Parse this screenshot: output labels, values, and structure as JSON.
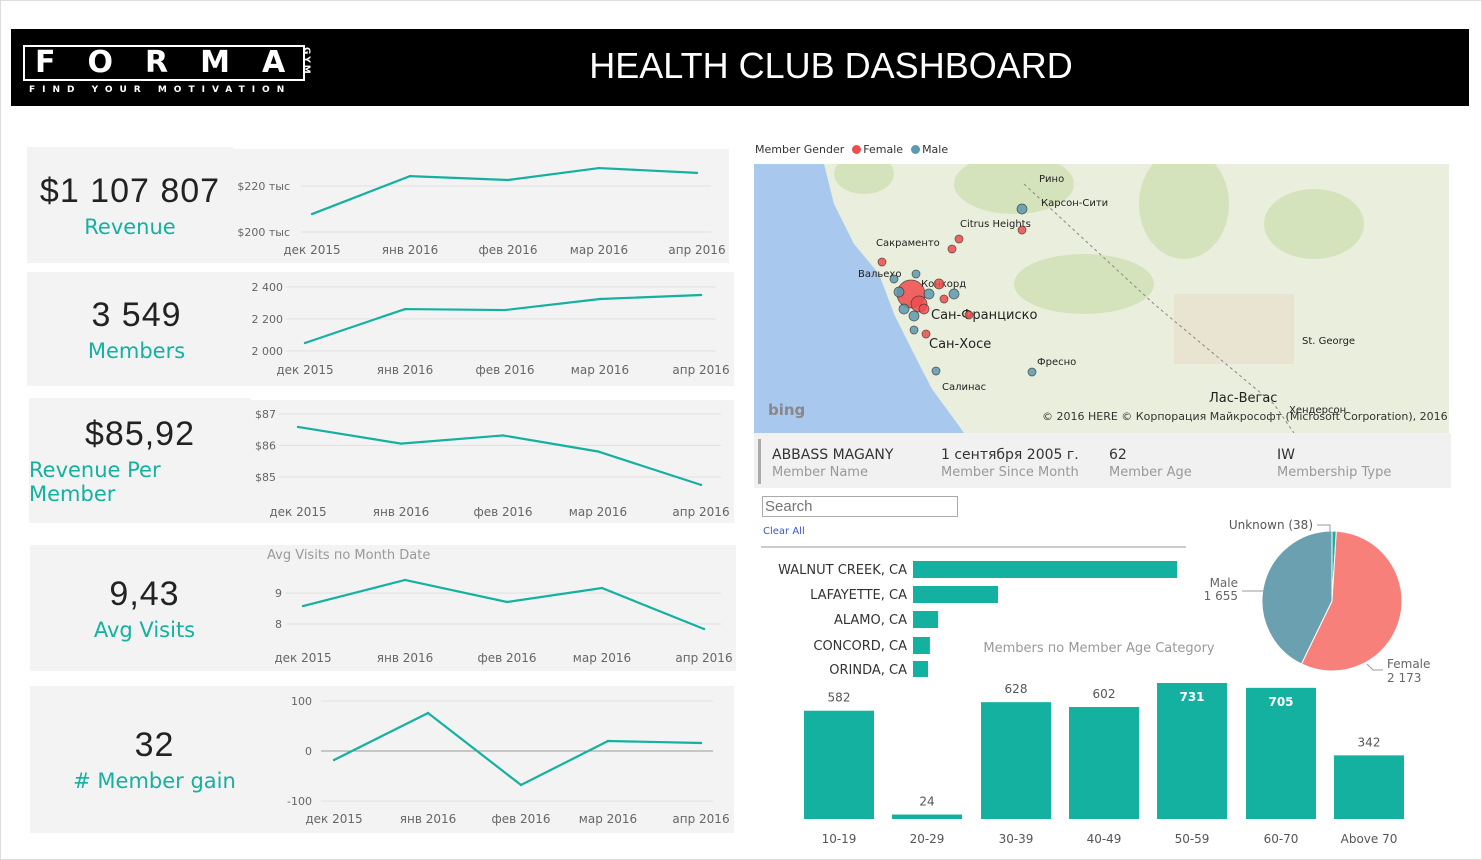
{
  "header": {
    "logo": "FORMA",
    "tagline": "FIND YOUR MOTIVATION",
    "logo_side": "GYM",
    "title": "HEALTH CLUB DASHBOARD"
  },
  "kpis": [
    {
      "value": "$1 107 807",
      "label": "Revenue"
    },
    {
      "value": "3 549",
      "label": "Members"
    },
    {
      "value": "$85,92",
      "label": "Revenue Per Member"
    },
    {
      "value": "9,43",
      "label": "Avg Visits"
    },
    {
      "value": "32",
      "label": "# Member gain"
    }
  ],
  "colors": {
    "accent": "#14b0a0",
    "female": "#f8807a",
    "male": "#6aa0b0",
    "unknown": "#14b0a0",
    "header": "#000000"
  },
  "chart_data": [
    {
      "type": "line",
      "title": "",
      "categories": [
        "дек 2015",
        "янв 2016",
        "фев 2016",
        "мар 2016",
        "апр 2016"
      ],
      "values": [
        207.8,
        224.3,
        222.6,
        227.8,
        225.7
      ],
      "yticks": [
        {
          "v": 200,
          "label": "$200 тыс"
        },
        {
          "v": 220,
          "label": "$220 тыс"
        }
      ],
      "ylabel": "",
      "unit": "тыс $"
    },
    {
      "type": "line",
      "title": "",
      "categories": [
        "дек 2015",
        "янв 2016",
        "фев 2016",
        "мар 2016",
        "апр 2016"
      ],
      "values": [
        2050,
        2262,
        2256,
        2325,
        2350
      ],
      "yticks": [
        {
          "v": 2000,
          "label": "2 000"
        },
        {
          "v": 2200,
          "label": "2 200"
        },
        {
          "v": 2400,
          "label": "2 400"
        }
      ]
    },
    {
      "type": "line",
      "title": "",
      "categories": [
        "дек 2015",
        "янв 2016",
        "фев 2016",
        "мар 2016",
        "апр 2016"
      ],
      "values": [
        86.59,
        86.06,
        86.32,
        85.81,
        84.75
      ],
      "yticks": [
        {
          "v": 85,
          "label": "$85"
        },
        {
          "v": 86,
          "label": "$86"
        },
        {
          "v": 87,
          "label": "$87"
        }
      ]
    },
    {
      "type": "line",
      "title": "Avg Visits по Month Date",
      "categories": [
        "дек 2015",
        "янв 2016",
        "фев 2016",
        "мар 2016",
        "апр 2016"
      ],
      "values": [
        8.58,
        9.42,
        8.71,
        9.16,
        7.84
      ],
      "yticks": [
        {
          "v": 8,
          "label": "8"
        },
        {
          "v": 9,
          "label": "9"
        }
      ]
    },
    {
      "type": "line",
      "title": "",
      "categories": [
        "дек 2015",
        "янв 2016",
        "фев 2016",
        "мар 2016",
        "апр 2016"
      ],
      "values": [
        -18,
        76,
        -68,
        20,
        16
      ],
      "yticks": [
        {
          "v": -100,
          "label": "-100"
        },
        {
          "v": 0,
          "label": "0"
        },
        {
          "v": 100,
          "label": "100"
        }
      ]
    },
    {
      "type": "bar",
      "orientation": "horizontal",
      "categories": [
        "WALNUT CREEK, CA",
        "LAFAYETTE, CA",
        "ALAMO, CA",
        "CONCORD, CA",
        "ORINDA, CA"
      ],
      "values": [
        1000,
        322,
        95,
        64,
        57
      ]
    },
    {
      "type": "bar",
      "title": "Members по Member Age Category",
      "categories": [
        "10-19",
        "20-29",
        "30-39",
        "40-49",
        "50-59",
        "60-70",
        "Above 70"
      ],
      "values": [
        582,
        24,
        628,
        602,
        731,
        705,
        342
      ]
    },
    {
      "type": "pie",
      "slices": [
        {
          "name": "Unknown",
          "value": 38,
          "label": "Unknown (38)"
        },
        {
          "name": "Female",
          "value": 2173,
          "label": "Female",
          "vlabel": "2 173"
        },
        {
          "name": "Male",
          "value": 1655,
          "label": "Male",
          "vlabel": "1 655"
        }
      ]
    }
  ],
  "map": {
    "title": "Member Gender",
    "legend": [
      "Female",
      "Male"
    ],
    "labels": [
      "Рино",
      "Карсон-Сити",
      "Citrus Heights",
      "Сакраменто",
      "Вальехо",
      "Конкорд",
      "Сан-Франциско",
      "Сан-Хосе",
      "Фресно",
      "Салинас",
      "St. George",
      "Лас-Вегас",
      "Хендерсон"
    ],
    "attribution": "© 2016 HERE   © Корпорация Майкрософт (Microsoft Corporation), 2016",
    "brand": "bing"
  },
  "member": {
    "name": "ABBASS MAGANY",
    "name_label": "Member Name",
    "since": "1 сентября 2005 г.",
    "since_label": "Member Since Month",
    "age": "62",
    "age_label": "Member Age",
    "type": "IW",
    "type_label": "Membership Type"
  },
  "slicer": {
    "placeholder": "Search",
    "clear": "Clear All"
  }
}
